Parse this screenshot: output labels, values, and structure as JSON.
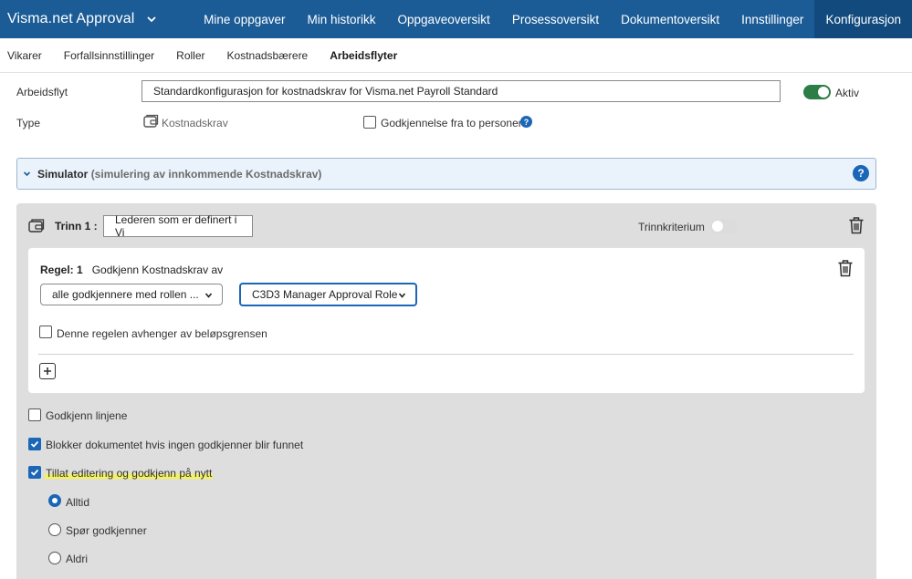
{
  "header": {
    "app_title": "Visma.net Approval",
    "nav": [
      "Mine oppgaver",
      "Min historikk",
      "Oppgaveoversikt",
      "Prosessoversikt",
      "Dokumentoversikt",
      "Innstillinger",
      "Konfigurasjon"
    ],
    "active_nav": "Konfigurasjon"
  },
  "subnav": {
    "items": [
      "Vikarer",
      "Forfallsinnstillinger",
      "Roller",
      "Kostnadsbærere",
      "Arbeidsflyter"
    ],
    "active": "Arbeidsflyter"
  },
  "workflow": {
    "label": "Arbeidsflyt",
    "value": "Standardkonfigurasjon for kostnadskrav for Visma.net Payroll Standard",
    "active_label": "Aktiv",
    "active": true,
    "type_label": "Type",
    "type_value": "Kostnadskrav",
    "two_person_label": "Godkjennelse fra to personer",
    "two_person_checked": false
  },
  "simulator": {
    "title": "Simulator",
    "subtitle": "(simulering av innkommende Kostnadskrav)"
  },
  "step": {
    "label": "Trinn 1 :",
    "name_value": "Lederen som er definert i Vi",
    "criteria_label": "Trinnkriterium",
    "criteria_on": false,
    "rule": {
      "label": "Regel: 1",
      "text": "Godkjenn Kostnadskrav av",
      "approver_select": "alle godkjennere med rollen ...",
      "role_select": "C3D3 Manager Approval Role",
      "amount_limit_label": "Denne regelen avhenger av beløpsgrensen",
      "amount_limit_checked": false
    },
    "options": {
      "approve_lines": "Godkjenn linjene",
      "block_document": "Blokker dokumentet hvis ingen godkjenner blir funnet",
      "allow_edit": "Tillat editering og godkjenn på nytt",
      "radio_always": "Alltid",
      "radio_ask": "Spør godkjenner",
      "radio_never": "Aldri"
    }
  },
  "colors": {
    "nav_bg": "#1b5c97",
    "nav_active": "#124a7e",
    "accent": "#1b66b6",
    "toggle_on": "#2d7d46",
    "highlight": "#f3f16a"
  }
}
